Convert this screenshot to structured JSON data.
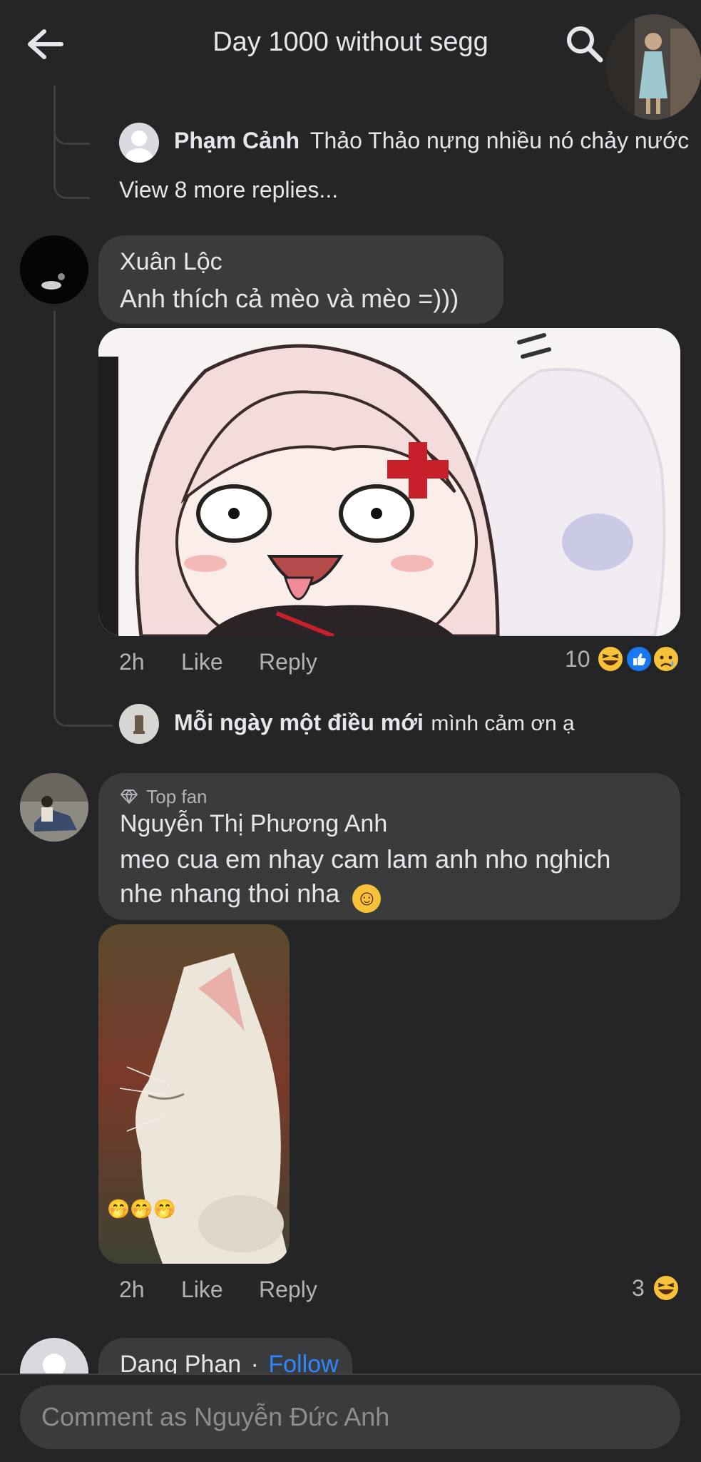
{
  "header": {
    "title": "Day 1000 without segg",
    "back_icon": "arrow-left-icon",
    "search_icon": "search-icon"
  },
  "replies_top": {
    "reply": {
      "name": "Phạm Cảnh",
      "text": "Thảo Thảo nựng nhiều nó chảy nước"
    },
    "view_more": "View 8 more replies..."
  },
  "comments": [
    {
      "name": "Xuân Lộc",
      "text": "Anh thích cả mèo và mèo =)))",
      "time": "2h",
      "like": "Like",
      "reply": "Reply",
      "reaction_count": "10",
      "reactions": [
        "laugh-reaction-icon",
        "like-reaction-icon",
        "sad-reaction-icon"
      ],
      "reply_preview": {
        "name": "Mỗi ngày một điều mới",
        "text": "mình cảm ơn ạ"
      }
    },
    {
      "badge": "Top fan",
      "badge_icon": "diamond-icon",
      "name": "Nguyễn Thị Phương Anh",
      "text_line1": "meo cua em nhay cam lam anh nho nghich",
      "text_line2": "nhe nhang thoi nha",
      "emoji": "☺",
      "sticker_emojis": "🤭🤭🤭",
      "time": "2h",
      "like": "Like",
      "reply": "Reply",
      "reaction_count": "3",
      "reactions": [
        "laugh-reaction-icon"
      ]
    },
    {
      "name": "Dang Phan",
      "separator": "·",
      "follow": "Follow"
    }
  ],
  "composer": {
    "placeholder": "Comment as Nguyễn Đức Anh"
  },
  "colors": {
    "background": "#242526",
    "bubble": "#3a3b3c",
    "text": "#e4e6eb",
    "secondary": "#b0b3b8",
    "link": "#2d88ff"
  }
}
